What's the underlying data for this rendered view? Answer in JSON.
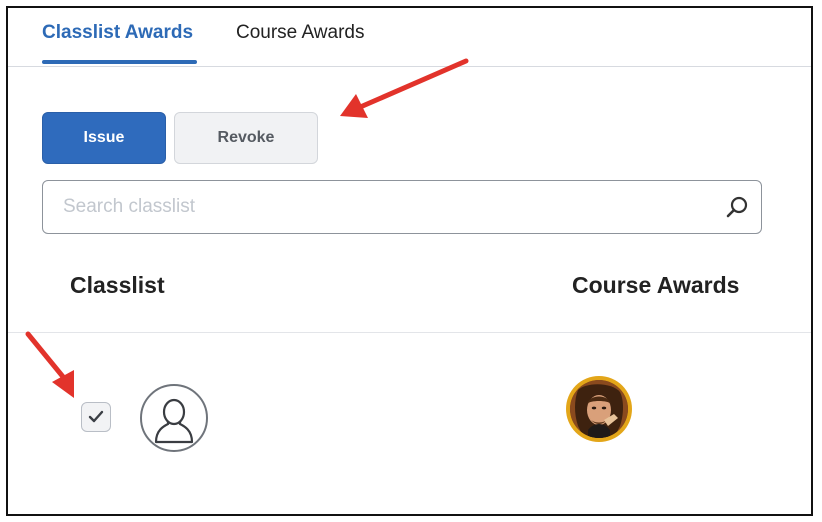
{
  "tabs": [
    {
      "label": "Classlist Awards",
      "active": true
    },
    {
      "label": "Course Awards",
      "active": false
    }
  ],
  "actions": {
    "issue_label": "Issue",
    "revoke_label": "Revoke"
  },
  "search": {
    "placeholder": "Search classlist",
    "value": "",
    "icon": "search-icon"
  },
  "table": {
    "columns": [
      "Classlist",
      "Course Awards"
    ],
    "rows": [
      {
        "selected": true,
        "user_avatar_icon": "user-placeholder-icon",
        "award_icon": "award-badge-image"
      }
    ]
  },
  "annotations": {
    "arrow_color": "#e2332b",
    "arrows": [
      "arrow-to-revoke-button",
      "arrow-to-row-checkbox"
    ]
  },
  "colors": {
    "accent": "#2d6ab6",
    "primary_button": "#2f6bbd",
    "secondary_button": "#f1f2f4",
    "badge_ring": "#e3a619",
    "arrow": "#e2332b"
  }
}
